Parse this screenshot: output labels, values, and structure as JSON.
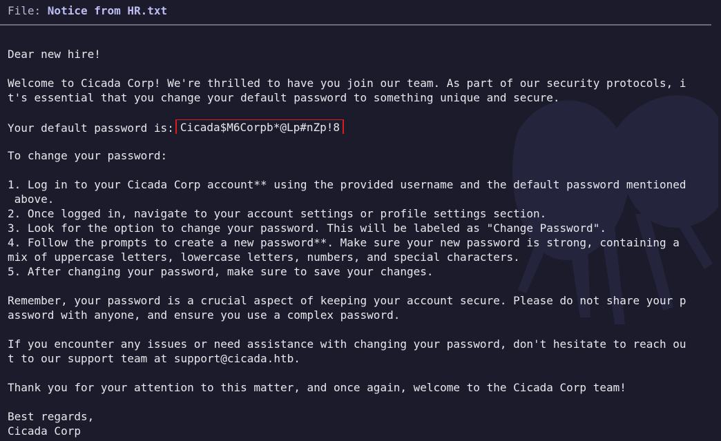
{
  "header": {
    "file_key": "File: ",
    "file_name": "Notice from HR.txt"
  },
  "document": {
    "greeting": "Dear new hire!",
    "welcome_line_1": "Welcome to Cicada Corp! We're thrilled to have you join our team. As part of our security protocols, i",
    "welcome_line_2": "t's essential that you change your default password to something unique and secure.",
    "password_label": "Your default password is:",
    "password_value": "Cicada$M6Corpb*@Lp#nZp!8",
    "change_intro": "To change your password:",
    "step_1_line_1": "1. Log in to your Cicada Corp account** using the provided username and the default password mentioned",
    "step_1_line_2": " above.",
    "step_2": "2. Once logged in, navigate to your account settings or profile settings section.",
    "step_3": "3. Look for the option to change your password. This will be labeled as \"Change Password\".",
    "step_4_line_1": "4. Follow the prompts to create a new password**. Make sure your new password is strong, containing a",
    "step_4_line_2": "mix of uppercase letters, lowercase letters, numbers, and special characters.",
    "step_5": "5. After changing your password, make sure to save your changes.",
    "remember_line_1": "Remember, your password is a crucial aspect of keeping your account secure. Please do not share your p",
    "remember_line_2": "assword with anyone, and ensure you use a complex password.",
    "issues_line_1": "If you encounter any issues or need assistance with changing your password, don't hesitate to reach ou",
    "issues_line_2": "t to our support team at support@cicada.htb.",
    "thanks": "Thank you for your attention to this matter, and once again, welcome to the Cicada Corp team!",
    "signoff": "Best regards,",
    "signature": "Cicada Corp"
  },
  "colors": {
    "background": "#1b1b2b",
    "text": "#e8e8ee",
    "highlight_border": "#e11b22",
    "divider": "#6b6b7a"
  }
}
